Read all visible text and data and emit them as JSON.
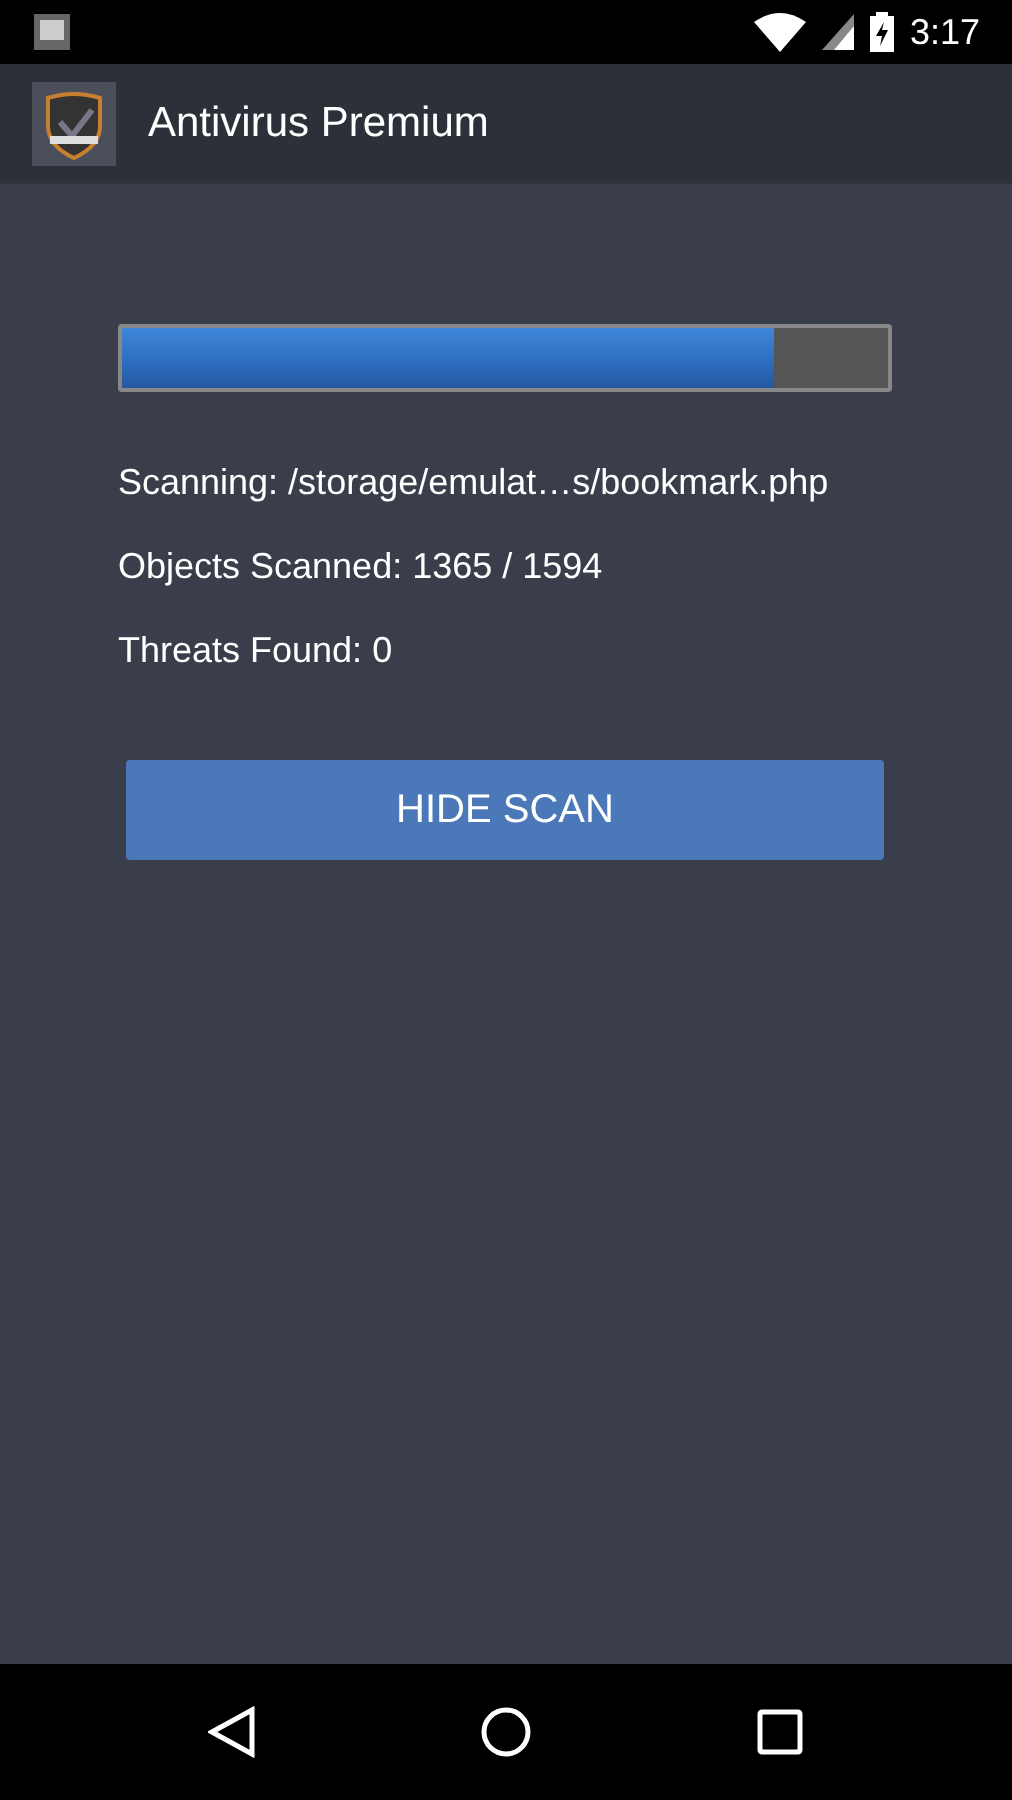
{
  "status_bar": {
    "time": "3:17"
  },
  "app_bar": {
    "title": "Antivirus Premium"
  },
  "scan": {
    "progress": {
      "level": 0.85
    },
    "lines": [
      "Scanning: /storage/emulat…s/bookmark.php",
      "Objects Scanned: 1365 / 1594",
      "Threats Found: 0"
    ],
    "button": "HIDE SCAN"
  }
}
